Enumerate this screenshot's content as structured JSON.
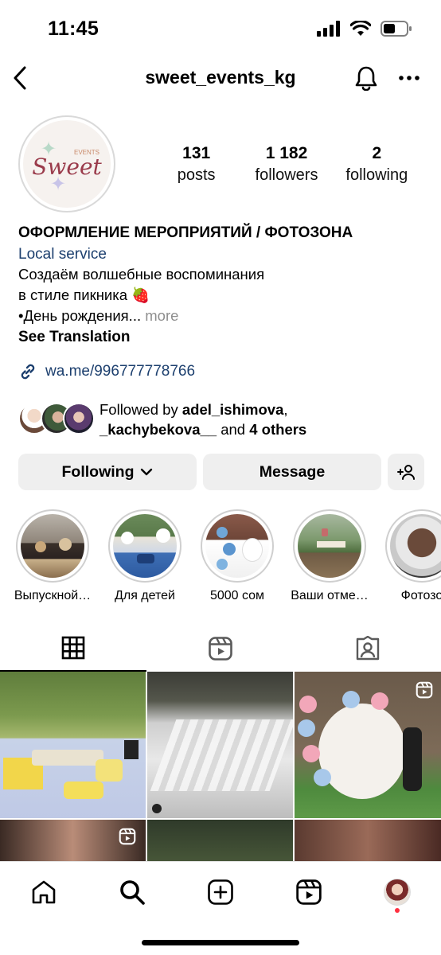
{
  "status_bar": {
    "time": "11:45"
  },
  "header": {
    "username": "sweet_events_kg"
  },
  "profile": {
    "logo_text": "Sweet",
    "logo_subtext": "EVENTS",
    "stats": [
      {
        "value": "131",
        "label": "posts"
      },
      {
        "value": "1 182",
        "label": "followers"
      },
      {
        "value": "2",
        "label": "following"
      }
    ]
  },
  "bio": {
    "name": "ОФОРМЛЕНИЕ МЕРОПРИЯТИЙ / ФОТОЗОНА",
    "category": "Local service",
    "line1": "Создаём волшебные воспоминания",
    "line2": "в стиле пикника 🍓",
    "line3": "•День рождения...",
    "more": "more",
    "see_translation": "See Translation",
    "link": "wa.me/996777778766"
  },
  "followed_by": {
    "prefix": "Followed by ",
    "user1": "adel_ishimova",
    "sep": ",",
    "user2": "_kachybekova__",
    "and": " and ",
    "others": "4 others"
  },
  "actions": {
    "following": "Following",
    "message": "Message"
  },
  "highlights": [
    {
      "label": "Выпускной…"
    },
    {
      "label": "Для детей"
    },
    {
      "label": "5000 сом"
    },
    {
      "label": "Ваши отме…"
    },
    {
      "label": "Фотозо"
    }
  ],
  "icons": {
    "back": "chevron-left-icon",
    "bell": "bell-icon",
    "more": "more-horizontal-icon",
    "link": "link-icon",
    "grid": "grid-icon",
    "reels": "reels-icon",
    "tagged": "tagged-icon",
    "home": "home-icon",
    "search": "search-icon",
    "create": "plus-square-icon",
    "profile": "avatar"
  },
  "colors": {
    "link_blue": "#1c3f6e",
    "button_bg": "#efefef",
    "muted": "#8e8e8e",
    "notification_dot": "#ff3040"
  }
}
